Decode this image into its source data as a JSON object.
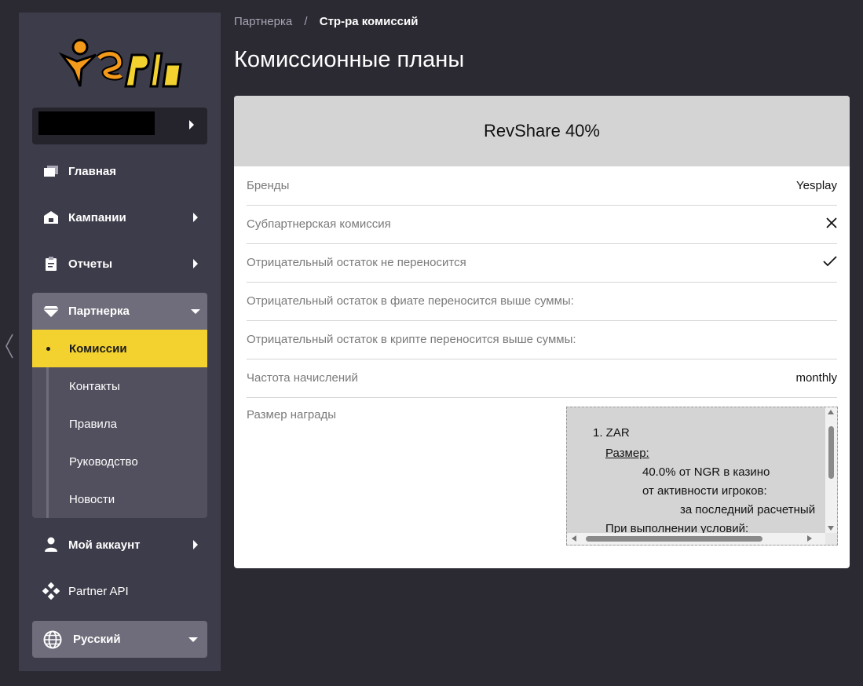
{
  "sidebar": {
    "logo_text": "Ye$Play",
    "nav": {
      "home": "Главная",
      "campaigns": "Кампании",
      "reports": "Отчеты",
      "partner": "Партнерка",
      "account": "Мой аккаунт",
      "api": "Partner API"
    },
    "partner_items": [
      "Комиссии",
      "Контакты",
      "Правила",
      "Руководство",
      "Новости"
    ],
    "language": "Русский"
  },
  "breadcrumb": {
    "parent": "Партнерка",
    "separator": "/",
    "current": "Стр-ра комиссий"
  },
  "page_title": "Комиссионные планы",
  "plan": {
    "title": "RevShare 40%",
    "rows": [
      {
        "key": "Бренды",
        "value": "Yesplay"
      },
      {
        "key": "Субпартнерская комиссия",
        "value": "",
        "icon": "cross-icon"
      },
      {
        "key": "Отрицательный остаток не переносится",
        "value": "",
        "icon": "check-icon"
      },
      {
        "key": "Отрицательный остаток в фиате переносится выше суммы:",
        "value": ""
      },
      {
        "key": "Отрицательный остаток в крипте переносится выше суммы:",
        "value": ""
      },
      {
        "key": "Частота начислений",
        "value": "monthly"
      }
    ],
    "reward_label": "Размер награды",
    "reward_lines": [
      "1. ZAR",
      "Размер:",
      "40.0% от NGR в казино",
      "от активности игроков:",
      "за последний расчетный",
      "При выполнении условий:"
    ]
  },
  "colors": {
    "background": "#2b2a33",
    "sidebar": "#3d3c4a",
    "accent": "#f3d22f",
    "card_header": "#d4d4d4"
  }
}
